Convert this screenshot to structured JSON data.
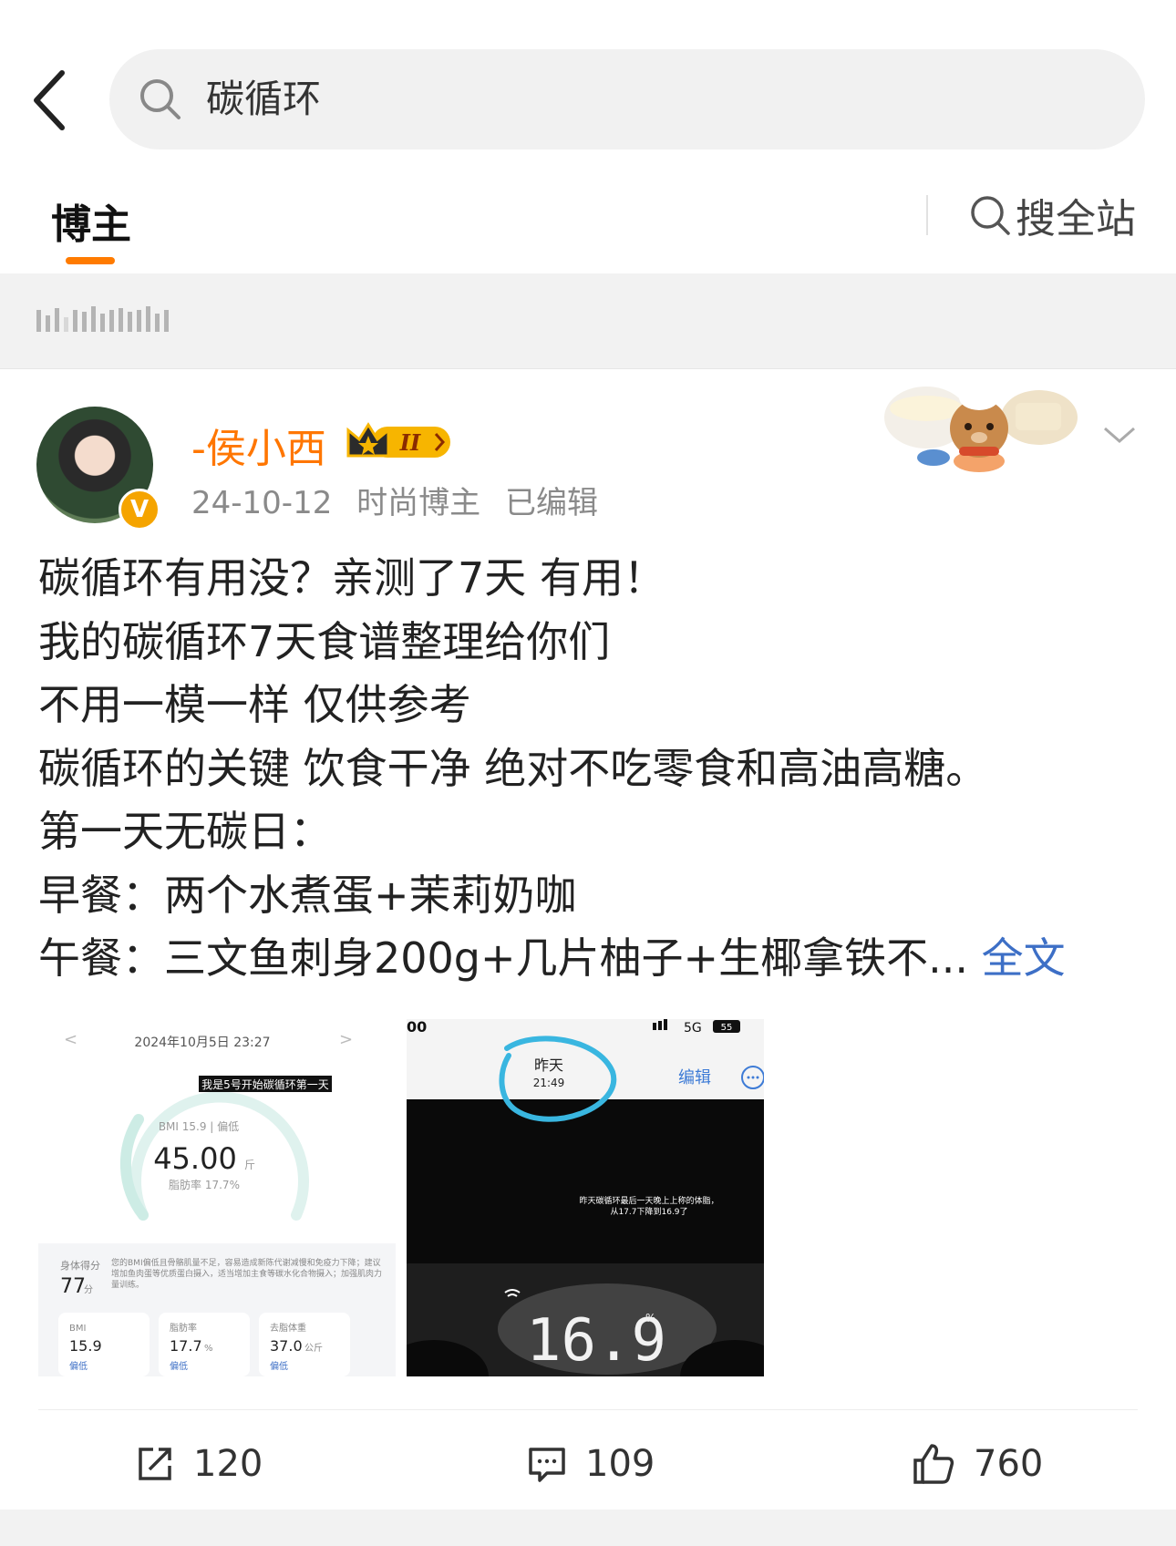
{
  "search": {
    "query": "碳循环"
  },
  "tabs": {
    "active": "博主",
    "site_search": "搜全站"
  },
  "post": {
    "author": "-侯小西",
    "vip_level": "II",
    "badge": "V",
    "date": "24-10-12",
    "category": "时尚博主",
    "edited": "已编辑",
    "lines": [
      "碳循环有用没？亲测了7天 有用！",
      "我的碳循环7天食谱整理给你们",
      "不用一模一样 仅供参考",
      "碳循环的关键 饮食干净 绝对不吃零食和高油高糖。",
      "第一天无碳日：",
      "早餐：两个水煮蛋+茉莉奶咖",
      "午餐：三文鱼刺身200g+几片柚子+生椰拿铁不..."
    ],
    "full_text": "全文"
  },
  "image1": {
    "date": "2024年10月5日 23:27",
    "caption": "我是5号开始碳循环第一天",
    "bmi_line": "BMI 15.9 | 偏低",
    "weight": "45.00",
    "weight_unit": "斤",
    "fat_line": "脂肪率 17.7%",
    "score_label": "身体得分",
    "score": "77",
    "score_unit": "分",
    "advice": "您的BMI偏低且骨骼肌量不足，容易造成新陈代谢减慢和免疫力下降；建议增加鱼肉蛋等优质蛋白摄入，适当增加主食等碳水化合物摄入；加强肌肉力量训练。",
    "cards": [
      {
        "label": "BMI",
        "value": "15.9",
        "unit": "",
        "status": "偏低"
      },
      {
        "label": "脂肪率",
        "value": "17.7",
        "unit": "%",
        "status": "偏低"
      },
      {
        "label": "去脂体重",
        "value": "37.0",
        "unit": "公斤",
        "status": "偏低"
      }
    ]
  },
  "image2": {
    "status_left": "00",
    "network": "5G",
    "battery": "55",
    "day": "昨天",
    "time": "21:49",
    "edit": "编辑",
    "caption": "昨天碳循环最后一天晚上上称的体脂，从17.7下降到16.9了",
    "reading": "16.9",
    "reading_unit": "%"
  },
  "actions": {
    "reposts": "120",
    "comments": "109",
    "likes": "760"
  },
  "colors": {
    "accent_orange": "#ff7600",
    "link_blue": "#3d6fc6",
    "tab_underline": "#ff7b00"
  }
}
